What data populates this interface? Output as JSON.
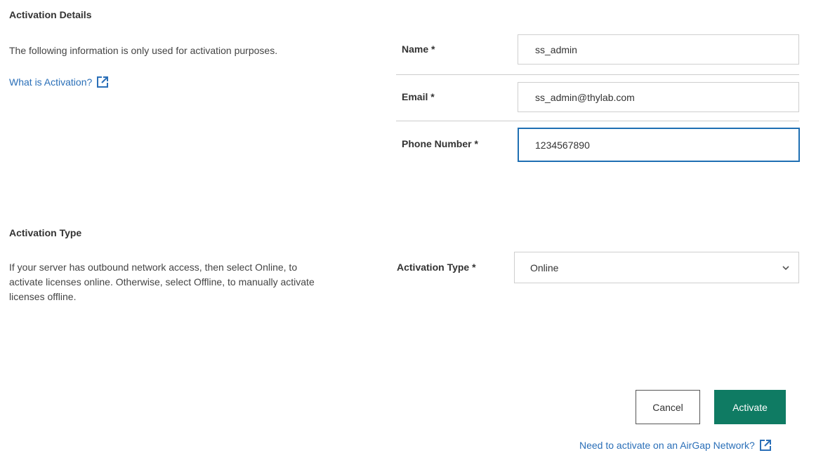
{
  "details": {
    "heading": "Activation Details",
    "description": "The following information is only used for activation purposes.",
    "link_label": "What is Activation?",
    "link_icon": "external-link-icon"
  },
  "form": {
    "name_label": "Name *",
    "name_value": "ss_admin",
    "email_label": "Email *",
    "email_value": "ss_admin@thylab.com",
    "phone_label": "Phone Number *",
    "phone_value": "1234567890"
  },
  "activation_type": {
    "heading": "Activation Type",
    "description": "If your server has outbound network access, then select Online, to activate licenses online. Otherwise, select Offline, to manually activate licenses offline.",
    "field_label": "Activation Type *",
    "selected": "Online",
    "dropdown_icon": "chevron-down-icon"
  },
  "actions": {
    "cancel_label": "Cancel",
    "activate_label": "Activate",
    "airgap_link_label": "Need to activate on an AirGap Network?",
    "airgap_link_icon": "external-link-icon"
  },
  "colors": {
    "link": "#2a6fb8",
    "primary": "#0f7b63",
    "focus_border": "#1f6fb3"
  }
}
